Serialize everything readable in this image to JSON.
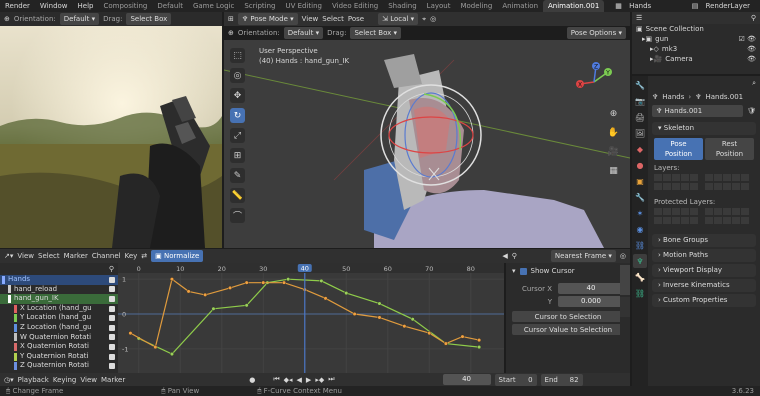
{
  "topbar": {
    "menus": [
      "Render",
      "Window",
      "Help"
    ],
    "tabs": [
      "Compositing",
      "Default",
      "Game Logic",
      "Scripting",
      "UV Editing",
      "Video Editing",
      "Shading",
      "Layout",
      "Modeling",
      "Animation",
      "Animation.001"
    ],
    "active_tab": "Animation.001",
    "scene": "Hands",
    "view_layer": "RenderLayer"
  },
  "left_view": {
    "orientation_label": "Orientation:",
    "orientation_value": "Default",
    "drag_label": "Drag:",
    "drag_value": "Select Box"
  },
  "viewport": {
    "mode": "Pose Mode",
    "menus": [
      "View",
      "Select",
      "Pose"
    ],
    "transform_space": "Local",
    "orientation_label": "Orientation:",
    "orientation_value": "Default",
    "drag_label": "Drag:",
    "drag_value": "Select Box",
    "pose_options": "Pose Options",
    "perspective": "User Perspective",
    "info": "(40) Hands : hand_gun_IK",
    "gizmo": {
      "x": "X",
      "y": "Y",
      "z": "Z"
    }
  },
  "outliner": {
    "rows": [
      {
        "label": "Scene Collection",
        "indent": 0
      },
      {
        "label": "gun",
        "indent": 1
      },
      {
        "label": "mk3",
        "indent": 2
      },
      {
        "label": "Camera",
        "indent": 2
      }
    ]
  },
  "properties": {
    "breadcrumb_obj": "Hands",
    "breadcrumb_data": "Hands.001",
    "data_name": "Hands.001",
    "skeleton_header": "Skeleton",
    "pose_position": "Pose Position",
    "rest_position": "Rest Position",
    "layers_label": "Layers:",
    "protected_layers_label": "Protected Layers:",
    "collapsed_sections": [
      "Bone Groups",
      "Motion Paths",
      "Viewport Display",
      "Inverse Kinematics",
      "Custom Properties"
    ],
    "version": "3.6.23"
  },
  "graph_editor": {
    "menus": [
      "View",
      "Select",
      "Marker",
      "Channel",
      "Key"
    ],
    "normalize": "Normalize",
    "pivot": "Nearest Frame",
    "current_frame": "40",
    "frame_ticks": [
      0,
      10,
      20,
      30,
      40,
      50,
      60,
      70,
      80
    ],
    "y_ticks": [
      "1",
      "0",
      "-1"
    ],
    "channels": [
      {
        "label": "Hands",
        "color": "#88aaff"
      },
      {
        "label": "hand_reload",
        "color": "#cccccc"
      },
      {
        "label": "hand_gun_IK",
        "color": "#ffffff"
      },
      {
        "label": "X Location (hand_gu",
        "color": "#e06060"
      },
      {
        "label": "Y Location (hand_gu",
        "color": "#7ccb52"
      },
      {
        "label": "Z Location (hand_gu",
        "color": "#5f8fe0"
      },
      {
        "label": "W Quaternion Rotati",
        "color": "#c0c0c0"
      },
      {
        "label": "X Quaternion Rotati",
        "color": "#d86a6a"
      },
      {
        "label": "Y Quaternion Rotati",
        "color": "#b2d04f"
      },
      {
        "label": "Z Quaternion Rotati",
        "color": "#6c8fe0"
      }
    ],
    "cursor_panel": {
      "show_cursor": "Show Cursor",
      "cursor_x_label": "Cursor X",
      "cursor_x_value": "40",
      "y_label": "Y",
      "y_value": "0.000",
      "to_selection": "Cursor to Selection",
      "value_to_selection": "Cursor Value to Selection"
    }
  },
  "timeline": {
    "menus": [
      "Playback",
      "Keying",
      "View",
      "Marker"
    ],
    "current_frame": "40",
    "start_label": "Start",
    "start_value": "0",
    "end_label": "End",
    "end_value": "82"
  },
  "statusbar": {
    "items": [
      "Change Frame",
      "Pan View",
      "F-Curve Context Menu"
    ]
  }
}
